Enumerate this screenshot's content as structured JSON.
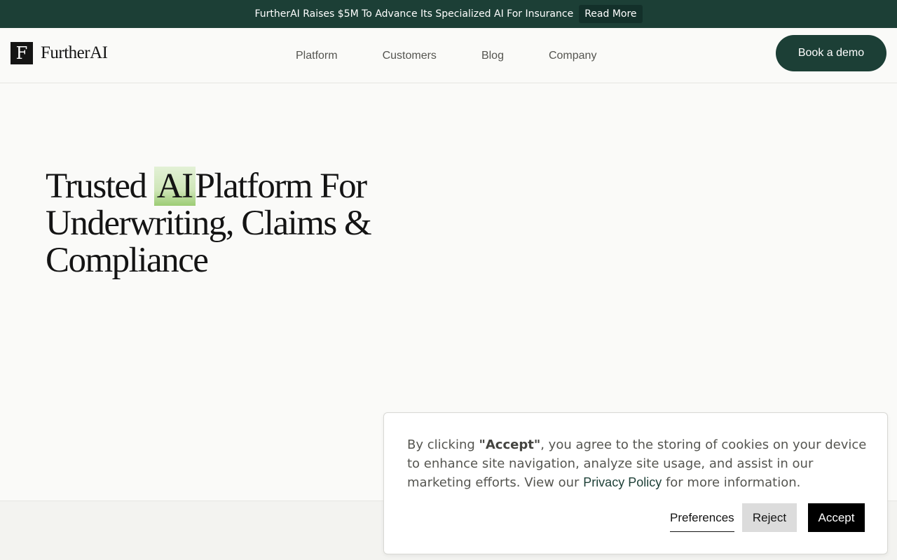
{
  "announcement": {
    "text": "FurtherAI Raises $5M To Advance Its Specialized AI For Insurance",
    "button_label": "Read More"
  },
  "header": {
    "logo_letter": "F",
    "logo_text": "FurtherAI",
    "nav": [
      {
        "label": "Platform"
      },
      {
        "label": "Customers"
      },
      {
        "label": "Blog"
      },
      {
        "label": "Company"
      }
    ],
    "cta_label": "Book a demo"
  },
  "hero": {
    "title_part1": "Trusted",
    "title_highlight": "AI",
    "title_part2": "Platform For Underwriting, Claims & Compliance",
    "highlight_color": "#b9dc9a"
  },
  "cookie_banner": {
    "text_before": "By clicking ",
    "text_bold": "\"Accept\"",
    "text_middle": ", you agree to the storing of cookies on your device to enhance site navigation, analyze site usage, and assist in our marketing efforts. View our ",
    "link_label": "Privacy Policy",
    "text_after": " for more information.",
    "preferences_label": "Preferences",
    "reject_label": "Reject",
    "accept_label": "Accept"
  },
  "colors": {
    "brand": "#1c3f36",
    "background": "#fafaf8"
  }
}
